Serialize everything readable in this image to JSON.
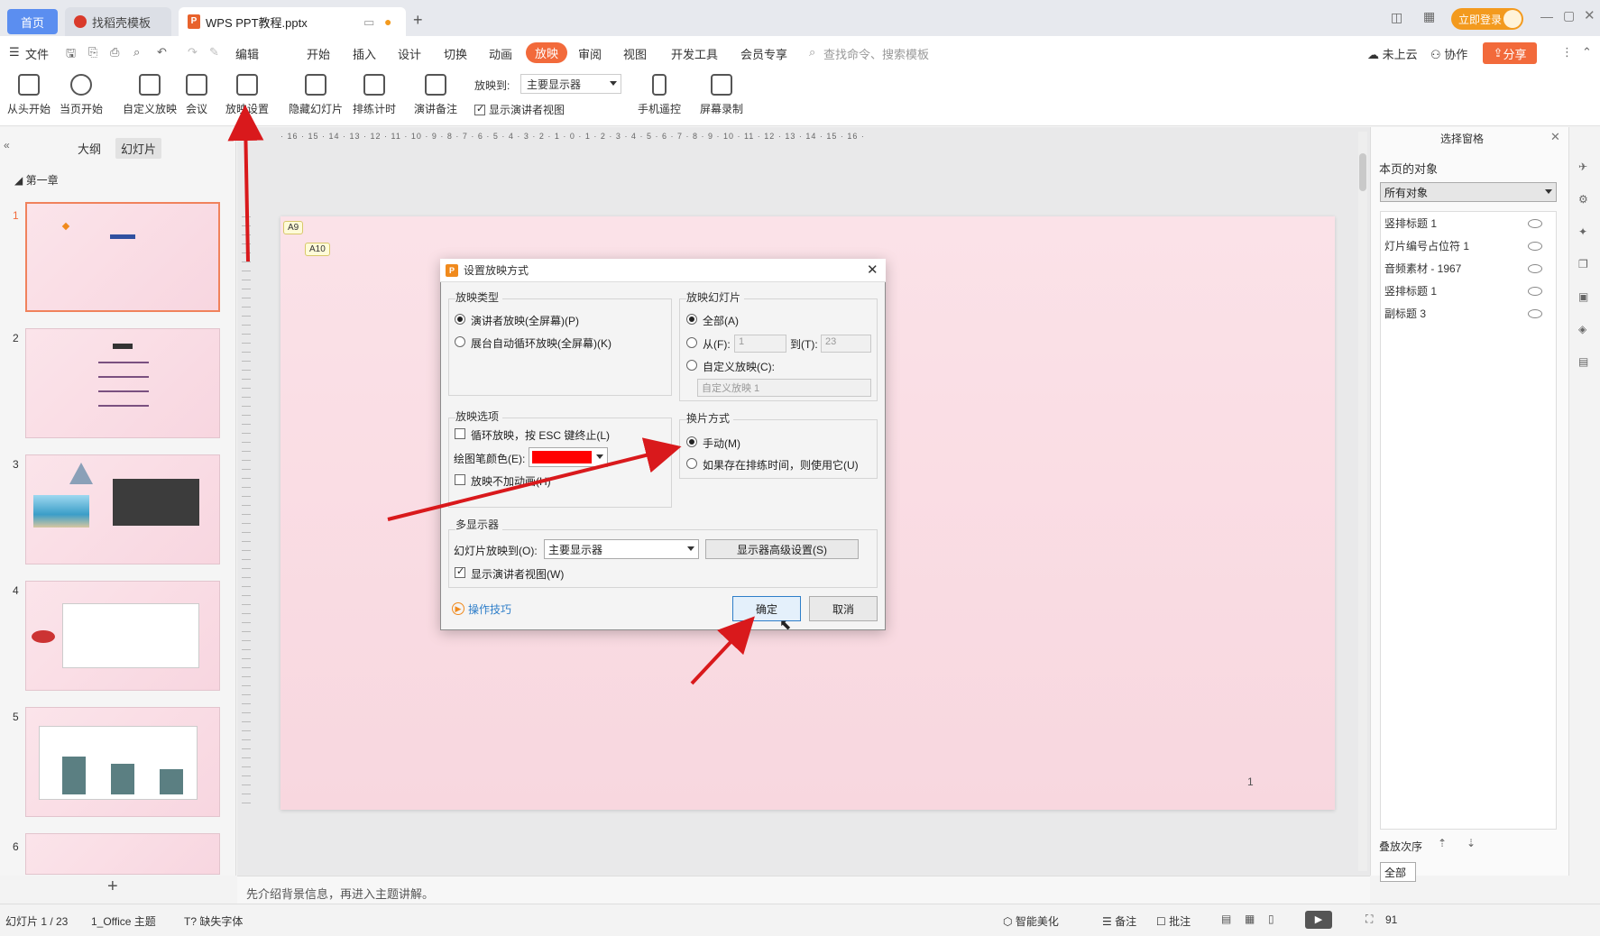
{
  "tabs": {
    "home": "首页",
    "template": "找稻壳模板",
    "document": "WPS PPT教程.pptx",
    "login": "立即登录"
  },
  "menu": {
    "file": "文件",
    "edit": "编辑",
    "items": [
      "开始",
      "插入",
      "设计",
      "切换",
      "动画",
      "放映",
      "审阅",
      "视图",
      "开发工具",
      "会员专享"
    ],
    "active": "放映",
    "search": "查找命令、搜索模板",
    "cloud": "未上云",
    "collab": "协作",
    "share": "分享"
  },
  "ribbon": {
    "from_start": "从头开始",
    "from_current": "当页开始",
    "custom_show": "自定义放映",
    "meeting": "会议",
    "show_settings": "放映设置",
    "hide_slide": "隐藏幻灯片",
    "rehearse": "排练计时",
    "speaker_notes": "演讲备注",
    "show_to_label": "放映到:",
    "show_to_value": "主要显示器",
    "presenter_view": "显示演讲者视图",
    "phone_remote": "手机遥控",
    "screen_record": "屏幕录制"
  },
  "left_panel": {
    "outline": "大纲",
    "slides": "幻灯片",
    "section": "第一章",
    "slide_numbers": [
      "1",
      "2",
      "3",
      "4",
      "5",
      "6"
    ]
  },
  "slide": {
    "tag1": "A9",
    "tag2": "A10",
    "page_number": "1"
  },
  "notes": "先介绍背景信息，再进入主题讲解。",
  "right_panel": {
    "title": "选择窗格",
    "objects_on_page": "本页的对象",
    "filter": "所有对象",
    "objects": [
      "竖排标题 1",
      "灯片编号占位符 1",
      "音频素材 - 1967",
      "竖排标题 1",
      "副标题 3"
    ],
    "stack_order": "叠放次序",
    "all_short": "全部"
  },
  "status": {
    "slide_count": "幻灯片 1 / 23",
    "theme": "1_Office 主题",
    "missing_font": "缺失字体",
    "smart_beautify": "智能美化",
    "notes": "备注",
    "comments": "批注",
    "zoom": "91"
  },
  "dialog": {
    "title": "设置放映方式",
    "show_type": "放映类型",
    "presenter_full": "演讲者放映(全屏幕)(P)",
    "kiosk": "展台自动循环放映(全屏幕)(K)",
    "show_slides": "放映幻灯片",
    "all": "全部(A)",
    "from": "从(F):",
    "from_value": "1",
    "to": "到(T):",
    "to_value": "23",
    "custom": "自定义放映(C):",
    "custom_value": "自定义放映 1",
    "show_options": "放映选项",
    "loop": "循环放映，按 ESC 键终止(L)",
    "pen_color": "绘图笔颜色(E):",
    "pen_color_hex": "#ff0000",
    "no_animation": "放映不加动画(H)",
    "advance": "换片方式",
    "manual": "手动(M)",
    "use_timings": "如果存在排练时间，则使用它(U)",
    "multi_display": "多显示器",
    "show_on": "幻灯片放映到(O):",
    "show_on_value": "主要显示器",
    "advanced_display": "显示器高级设置(S)",
    "show_presenter_view": "显示演讲者视图(W)",
    "tips": "操作技巧",
    "ok": "确定",
    "cancel": "取消"
  },
  "colors": {
    "accent": "#f26a3b",
    "annotation_arrow": "#d9191c"
  }
}
